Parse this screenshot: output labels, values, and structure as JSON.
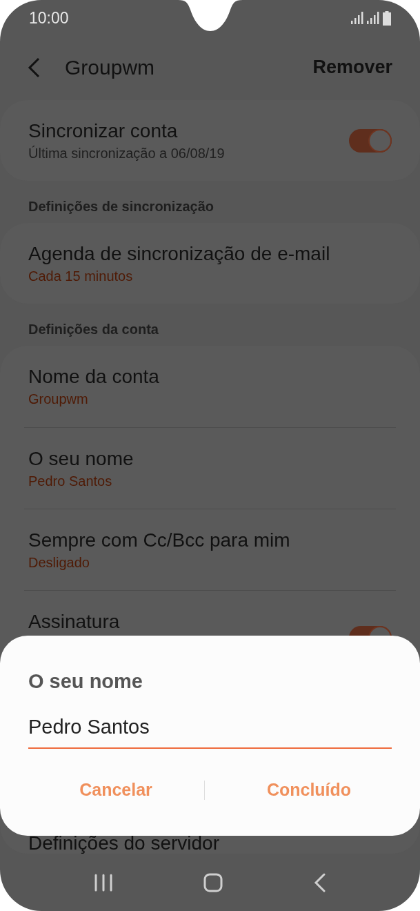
{
  "status_bar": {
    "time": "10:00"
  },
  "header": {
    "title": "Groupwm",
    "action": "Remover"
  },
  "settings": [
    {
      "kind": "card",
      "rows": [
        {
          "title": "Sincronizar conta",
          "subtitle": "Última sincronização a 06/08/19",
          "accent": false,
          "toggle": {
            "on": true
          }
        }
      ]
    },
    {
      "kind": "heading",
      "text": "Definições de sincronização"
    },
    {
      "kind": "card",
      "rows": [
        {
          "title": "Agenda de sincronização de e-mail",
          "subtitle": "Cada 15 minutos",
          "accent": true
        }
      ]
    },
    {
      "kind": "heading",
      "text": "Definições da conta"
    },
    {
      "kind": "card",
      "rows": [
        {
          "title": "Nome da conta",
          "subtitle": "Groupwm",
          "accent": true
        },
        {
          "title": "O seu nome",
          "subtitle": "Pedro Santos",
          "accent": true
        },
        {
          "title": "Sempre com Cc/Bcc para mim",
          "subtitle": "Desligado",
          "accent": true
        },
        {
          "title": "Assinatura",
          "toggle": {
            "on": true
          }
        },
        {
          "title": "Definições do servidor"
        }
      ]
    }
  ],
  "dialog": {
    "title": "O seu nome",
    "value": "Pedro Santos",
    "buttons": [
      "Cancelar",
      "Concluído"
    ]
  }
}
